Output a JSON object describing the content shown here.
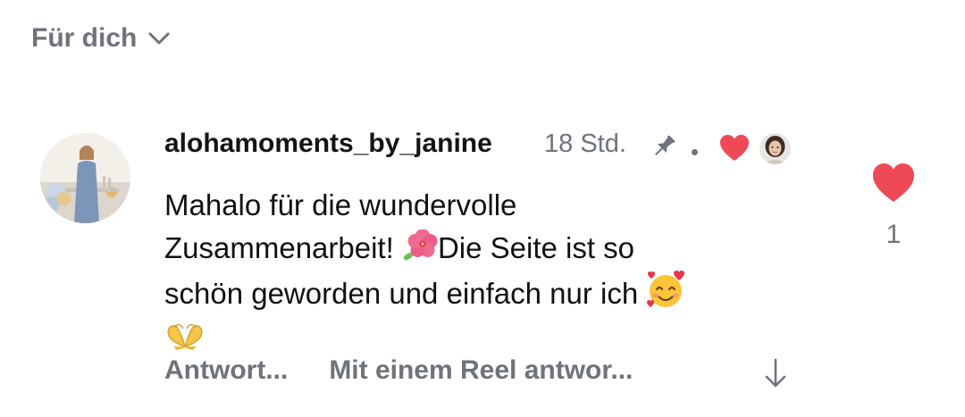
{
  "header": {
    "sort_label": "Für dich",
    "sort_icon": "chevron-down-icon"
  },
  "comment": {
    "username": "alohamoments_by_janine",
    "time": "18 Std.",
    "pinned_icon": "pin-icon",
    "author_liked_icon": "heart-icon",
    "text_lines": [
      "Mahalo für die wundervolle",
      "Zusammenarbeit! ",
      "Die Seite ist so",
      "schön geworden und einfach nur ich "
    ],
    "emojis": [
      "hibiscus",
      "smiling-face-with-hearts",
      "heart-hands"
    ],
    "like_count": "1",
    "like_color": "#ed4956"
  },
  "actions": {
    "reply_label": "Antwort...",
    "reel_reply_label": "Mit einem Reel antwor...",
    "scroll_icon": "arrow-down-icon"
  },
  "colors": {
    "muted": "#6f737a",
    "text": "#111111",
    "heart": "#ed4956"
  }
}
